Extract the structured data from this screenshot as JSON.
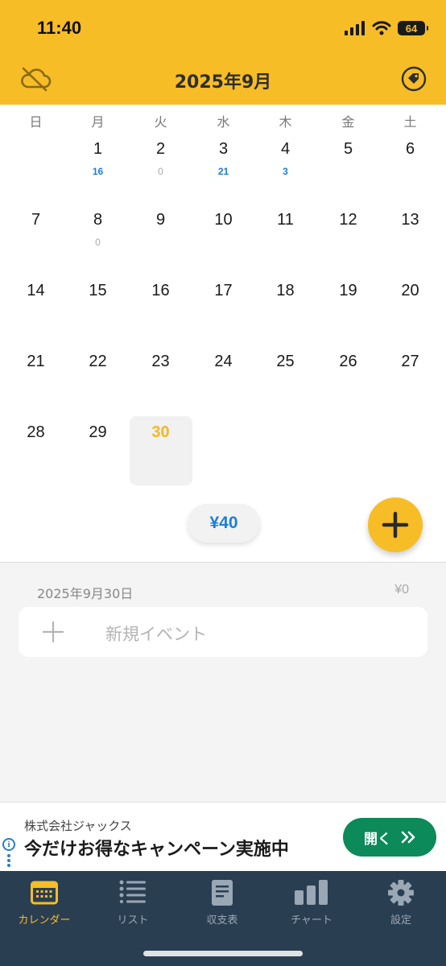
{
  "status_bar": {
    "time": "11:40",
    "battery": "64"
  },
  "header": {
    "title": "2025年9月",
    "left_icon": "cloud-off-icon",
    "right_icon": "tag-icon"
  },
  "calendar": {
    "weekdays": [
      "日",
      "月",
      "火",
      "水",
      "木",
      "金",
      "土"
    ],
    "weeks": [
      [
        {
          "day": ""
        },
        {
          "day": "1",
          "sub": "16"
        },
        {
          "day": "2",
          "sub": "0"
        },
        {
          "day": "3",
          "sub": "21"
        },
        {
          "day": "4",
          "sub": "3"
        },
        {
          "day": "5"
        },
        {
          "day": "6"
        }
      ],
      [
        {
          "day": "7"
        },
        {
          "day": "8",
          "sub": "0"
        },
        {
          "day": "9"
        },
        {
          "day": "10"
        },
        {
          "day": "11"
        },
        {
          "day": "12"
        },
        {
          "day": "13"
        }
      ],
      [
        {
          "day": "14"
        },
        {
          "day": "15"
        },
        {
          "day": "16"
        },
        {
          "day": "17"
        },
        {
          "day": "18"
        },
        {
          "day": "19"
        },
        {
          "day": "20"
        }
      ],
      [
        {
          "day": "21"
        },
        {
          "day": "22"
        },
        {
          "day": "23"
        },
        {
          "day": "24"
        },
        {
          "day": "25"
        },
        {
          "day": "26"
        },
        {
          "day": "27"
        }
      ],
      [
        {
          "day": "28"
        },
        {
          "day": "29"
        },
        {
          "day": "30"
        },
        {
          "day": ""
        },
        {
          "day": ""
        },
        {
          "day": ""
        },
        {
          "day": ""
        }
      ]
    ],
    "today": "30",
    "month_total": "¥40"
  },
  "day_detail": {
    "date": "2025年9月30日",
    "total": "¥0",
    "new_event_placeholder": "新規イベント"
  },
  "ad": {
    "company": "株式会社ジャックス",
    "text": "今だけお得なキャンペーン実施中",
    "button": "開く"
  },
  "tabs": [
    {
      "label": "カレンダー",
      "icon": "calendar-icon",
      "active": true
    },
    {
      "label": "リスト",
      "icon": "list-icon",
      "active": false
    },
    {
      "label": "収支表",
      "icon": "document-icon",
      "active": false
    },
    {
      "label": "チャート",
      "icon": "bar-chart-icon",
      "active": false
    },
    {
      "label": "設定",
      "icon": "gear-icon",
      "active": false
    }
  ],
  "colors": {
    "accent": "#f7bd26",
    "blue": "#1a7fd6",
    "tabbar": "#2a3e52",
    "ad_button": "#0c8a59"
  }
}
